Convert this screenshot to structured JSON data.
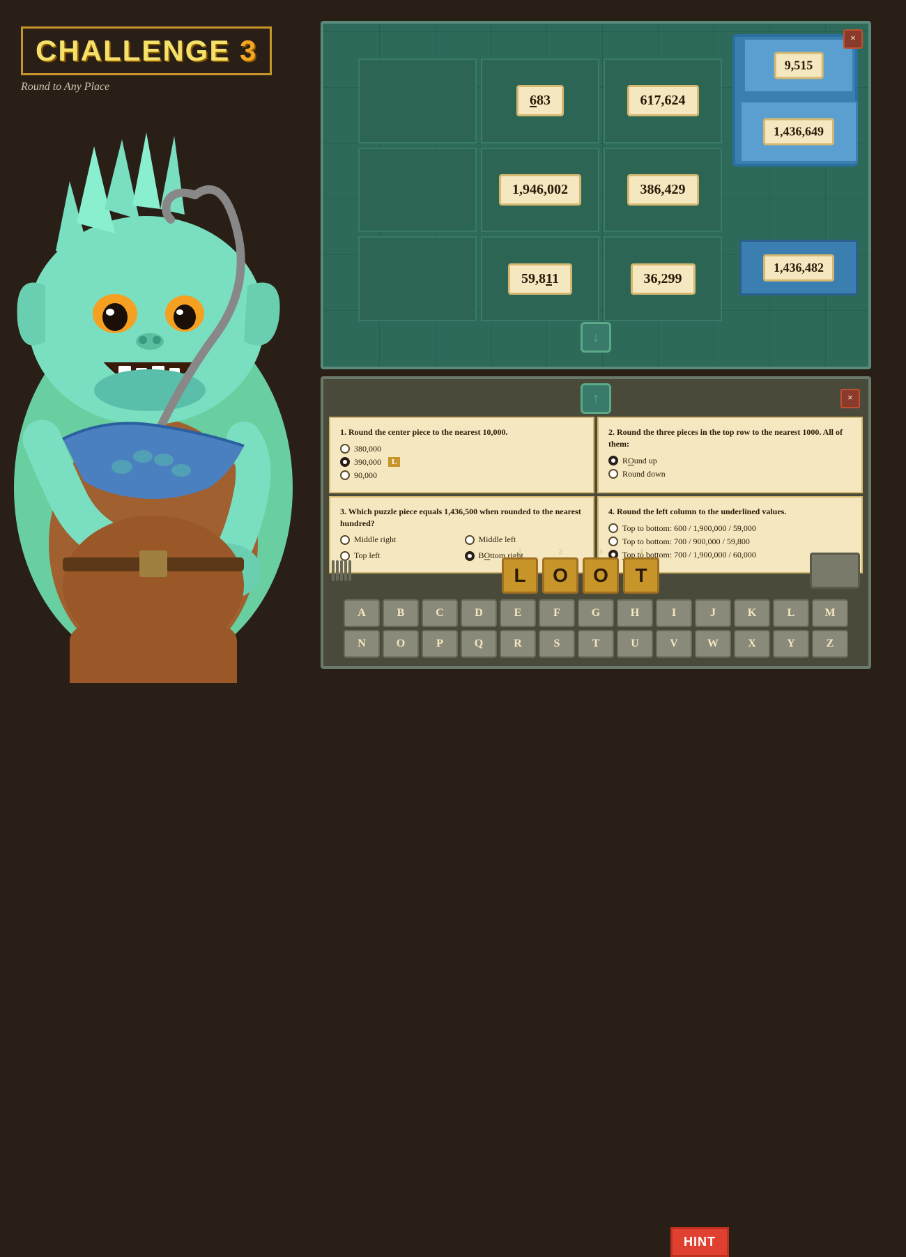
{
  "header": {
    "challenge_label": "CHALLENGE",
    "challenge_number": "3",
    "subtitle": "Round to Any Place"
  },
  "puzzle_panel": {
    "close_label": "×",
    "grid": [
      {
        "id": "top-left",
        "value": "",
        "empty": true
      },
      {
        "id": "top-mid",
        "value": "683",
        "underline_index": 0
      },
      {
        "id": "top-right",
        "value": "617,624"
      },
      {
        "id": "mid-left",
        "value": "",
        "empty": true
      },
      {
        "id": "mid-mid",
        "value": "1,946,002"
      },
      {
        "id": "mid-right",
        "value": "386,429"
      },
      {
        "id": "bot-left",
        "value": "",
        "empty": true
      },
      {
        "id": "bot-mid",
        "value": "59,811",
        "underline_index": 1
      },
      {
        "id": "bot-right-mid",
        "value": "36,299"
      },
      {
        "id": "bot-right",
        "value": "1,436,482"
      }
    ],
    "floating_top": "9,515",
    "floating_bottom": "1,436,649",
    "down_arrow": "↓",
    "up_arrow": "↑"
  },
  "questions": [
    {
      "number": "1",
      "text": "Round the center piece to the nearest 10,000.",
      "options": [
        {
          "value": "380,000",
          "selected": false
        },
        {
          "value": "390,000",
          "selected": true,
          "badge": "L"
        },
        {
          "value": "90,000",
          "selected": false
        }
      ]
    },
    {
      "number": "2",
      "text": "Round the three pieces in the top row to the nearest 1000. All of them:",
      "options": [
        {
          "value": "Round up",
          "selected": true
        },
        {
          "value": "Round down",
          "selected": false
        }
      ]
    },
    {
      "number": "3",
      "text": "Which puzzle piece equals 1,436,500 when rounded to the nearest hundred?",
      "options": [
        {
          "value": "Middle right",
          "selected": false
        },
        {
          "value": "Middle left",
          "selected": false
        },
        {
          "value": "Top left",
          "selected": false
        },
        {
          "value": "Bottom right",
          "selected": true,
          "badge": "O"
        }
      ]
    },
    {
      "number": "4",
      "text": "Round the left column to the underlined values.",
      "options": [
        {
          "value": "Top to bottom: 600 / 1,900,000 / 59,000",
          "selected": false
        },
        {
          "value": "Top to bottom: 700 / 900,000 / 59,800",
          "selected": false
        },
        {
          "value": "Top to bottom: 700 / 1,900,000 / 60,000",
          "selected": true,
          "badge": "T"
        }
      ]
    }
  ],
  "loot": {
    "slots": [
      {
        "number": "1",
        "letter": "L"
      },
      {
        "number": "2",
        "letter": "O"
      },
      {
        "number": "3",
        "letter": "O"
      },
      {
        "number": "4",
        "letter": "T"
      }
    ]
  },
  "hint_btn": "HINT",
  "keyboard": {
    "row1": [
      "A",
      "B",
      "C",
      "D",
      "E",
      "F",
      "G",
      "H",
      "I",
      "J",
      "K",
      "L",
      "M"
    ],
    "row2": [
      "N",
      "O",
      "P",
      "Q",
      "R",
      "S",
      "T",
      "U",
      "V",
      "W",
      "X",
      "Y",
      "Z"
    ]
  },
  "icons": {
    "close": "×",
    "arrow_down": "↓",
    "arrow_up": "↑"
  }
}
